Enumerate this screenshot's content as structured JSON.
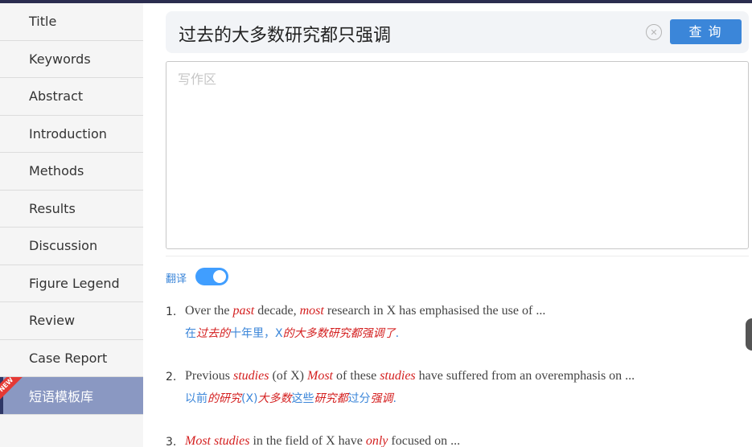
{
  "sidebar": {
    "items": [
      {
        "label": "Title",
        "active": false
      },
      {
        "label": "Keywords",
        "active": false
      },
      {
        "label": "Abstract",
        "active": false
      },
      {
        "label": "Introduction",
        "active": false
      },
      {
        "label": "Methods",
        "active": false
      },
      {
        "label": "Results",
        "active": false
      },
      {
        "label": "Discussion",
        "active": false
      },
      {
        "label": "Figure Legend",
        "active": false
      },
      {
        "label": "Review",
        "active": false
      },
      {
        "label": "Case Report",
        "active": false
      },
      {
        "label": "短语模板库",
        "active": true,
        "badge": "NEW"
      }
    ]
  },
  "search": {
    "value": "过去的大多数研究都只强调",
    "clear_icon": "close-circle-icon",
    "button_label": "查询"
  },
  "editor": {
    "placeholder": "写作区"
  },
  "translate": {
    "label": "翻译",
    "enabled": true
  },
  "phrases": [
    {
      "number": "1.",
      "en": [
        {
          "t": "Over the ",
          "hl": false
        },
        {
          "t": "past",
          "hl": true
        },
        {
          "t": " decade, ",
          "hl": false
        },
        {
          "t": "most",
          "hl": true
        },
        {
          "t": " research in X has emphasised the use of ...",
          "hl": false
        }
      ],
      "zh": [
        {
          "t": "在",
          "hl": false
        },
        {
          "t": "过去的",
          "hl": true
        },
        {
          "t": "十年里，X",
          "hl": false
        },
        {
          "t": "的大多数研究都强调了",
          "hl": true
        },
        {
          "t": ".",
          "hl": false
        }
      ]
    },
    {
      "number": "2.",
      "en": [
        {
          "t": "Previous ",
          "hl": false
        },
        {
          "t": "studies",
          "hl": true
        },
        {
          "t": " (of X) ",
          "hl": false
        },
        {
          "t": "Most",
          "hl": true
        },
        {
          "t": " of these ",
          "hl": false
        },
        {
          "t": "studies",
          "hl": true
        },
        {
          "t": " have suffered from an overemphasis on ...",
          "hl": false
        }
      ],
      "zh": [
        {
          "t": "以前",
          "hl": false
        },
        {
          "t": "的研究",
          "hl": true
        },
        {
          "t": "(X)",
          "hl": false
        },
        {
          "t": "大多数",
          "hl": true
        },
        {
          "t": "这些",
          "hl": false
        },
        {
          "t": "研究都",
          "hl": true
        },
        {
          "t": "过分",
          "hl": false
        },
        {
          "t": "强调",
          "hl": true
        },
        {
          "t": ".",
          "hl": false
        }
      ]
    },
    {
      "number": "3.",
      "en": [
        {
          "t": "Most studies",
          "hl": true
        },
        {
          "t": " in the field of X have ",
          "hl": false
        },
        {
          "t": "only",
          "hl": true
        },
        {
          "t": " focused on ...",
          "hl": false
        }
      ],
      "zh": []
    }
  ],
  "colors": {
    "accent": "#3b86d9",
    "highlight": "#d42020",
    "sidebar_active": "#8a98c2"
  }
}
